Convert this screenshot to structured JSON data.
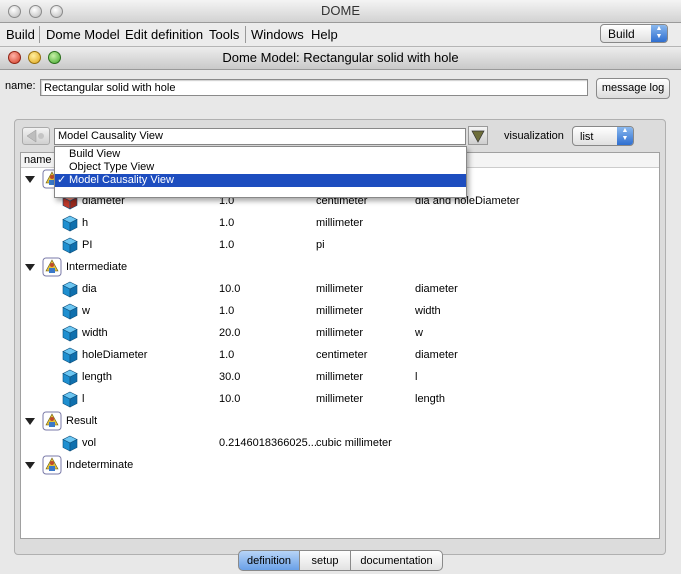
{
  "app": {
    "title": "DOME",
    "menu": [
      "Build",
      "Dome Model",
      "Edit definition",
      "Tools",
      "Windows",
      "Help"
    ],
    "mode_select": "Build"
  },
  "window": {
    "title": "Dome Model: Rectangular solid with hole",
    "name_label": "name:",
    "name_value": "Rectangular solid with hole",
    "message_log_button": "message log"
  },
  "view": {
    "selected": "Model Causality View",
    "options": [
      "Build View",
      "Object Type View",
      "Model Causality View"
    ],
    "visualization_label": "visualization",
    "visualization_value": "list"
  },
  "table": {
    "header_name": "name",
    "rows": [
      {
        "type": "group",
        "name": ""
      },
      {
        "type": "param",
        "name": "diameter",
        "value": "1.0",
        "unit": "centimeter",
        "causality": "dia and holeDiameter"
      },
      {
        "type": "param",
        "name": "h",
        "value": "1.0",
        "unit": "millimeter",
        "causality": ""
      },
      {
        "type": "param",
        "name": "PI",
        "value": "1.0",
        "unit": "pi",
        "causality": ""
      },
      {
        "type": "group",
        "name": "Intermediate"
      },
      {
        "type": "param",
        "name": "dia",
        "value": "10.0",
        "unit": "millimeter",
        "causality": "diameter"
      },
      {
        "type": "param",
        "name": "w",
        "value": "1.0",
        "unit": "millimeter",
        "causality": "width"
      },
      {
        "type": "param",
        "name": "width",
        "value": "20.0",
        "unit": "millimeter",
        "causality": "w"
      },
      {
        "type": "param",
        "name": "holeDiameter",
        "value": "1.0",
        "unit": "centimeter",
        "causality": "diameter"
      },
      {
        "type": "param",
        "name": "length",
        "value": "30.0",
        "unit": "millimeter",
        "causality": "l"
      },
      {
        "type": "param",
        "name": "l",
        "value": "10.0",
        "unit": "millimeter",
        "causality": "length"
      },
      {
        "type": "group",
        "name": "Result"
      },
      {
        "type": "param",
        "name": "vol",
        "value": "0.2146018366025...",
        "unit": "cubic millimeter",
        "causality": ""
      },
      {
        "type": "group",
        "name": "Indeterminate"
      }
    ]
  },
  "tabs": [
    "definition",
    "setup",
    "documentation"
  ],
  "active_tab": "definition",
  "icons": {
    "group": "causality-group-icon",
    "param": "parameter-cube-icon",
    "back": "back-arrow-icon"
  },
  "colors": {
    "selection": "#1d4dbf",
    "cube": "#1e8fd0",
    "active_tab": "#6aa0e8"
  }
}
